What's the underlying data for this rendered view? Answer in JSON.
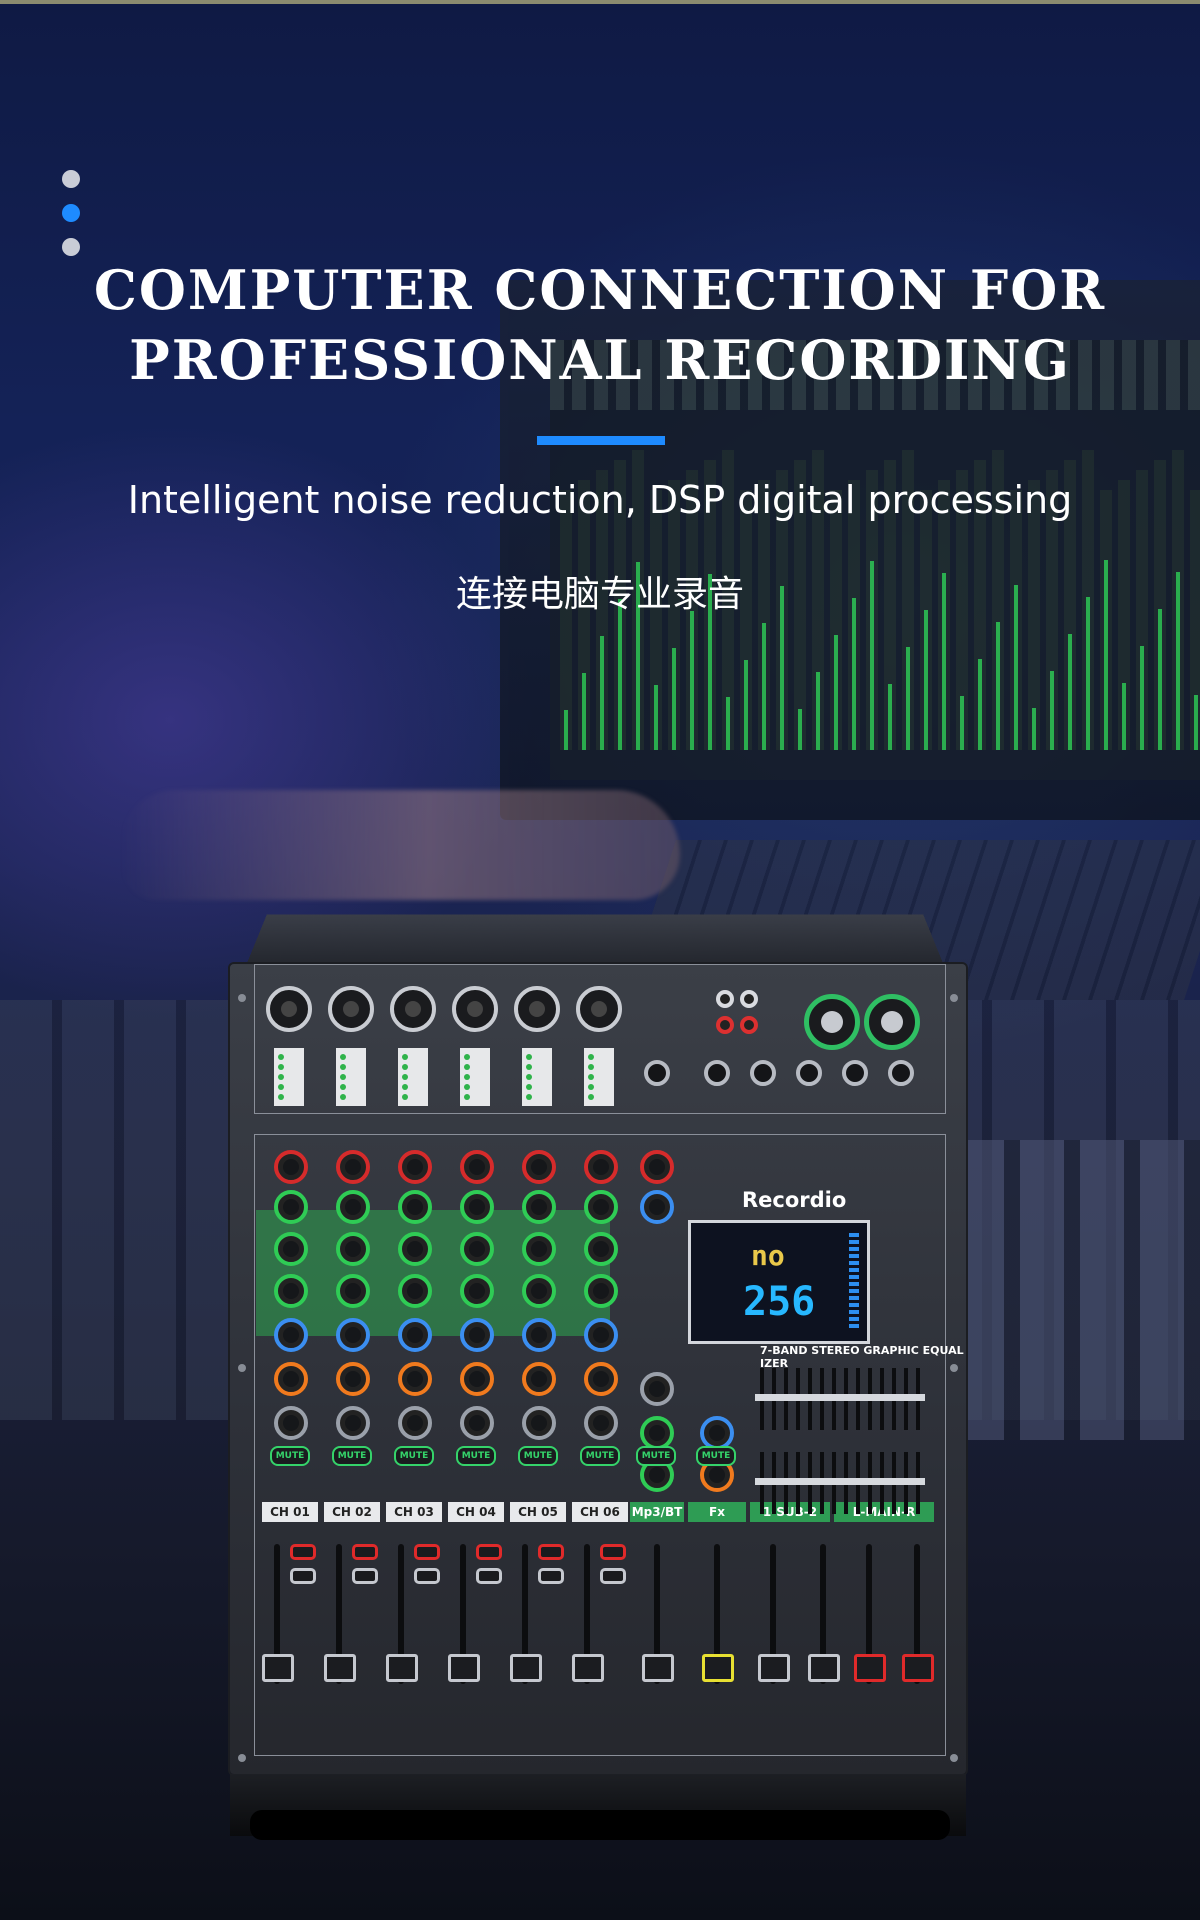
{
  "hero": {
    "headline_line1": "COMPUTER CONNECTION FOR",
    "headline_line2": "PROFESSIONAL RECORDING",
    "subtitle": "Intelligent noise reduction, DSP digital processing",
    "subtitle_cn": "连接电脑专业录音",
    "accent_color": "#1e8bff"
  },
  "carousel": {
    "count": 3,
    "active_index": 1
  },
  "mixer": {
    "brand": "Recordio",
    "channels": [
      "CH 01",
      "CH 02",
      "CH 03",
      "CH 04",
      "CH 05",
      "CH 06"
    ],
    "bus_labels": [
      "Mp3/BT",
      "Fx",
      "1-SUB-2",
      "L-MAIN-R"
    ],
    "mute_label": "MUTE",
    "display": {
      "top": "no",
      "value": "256"
    },
    "eq_title": "7-BAND STEREO GRAPHIC EQUAL IZER"
  }
}
